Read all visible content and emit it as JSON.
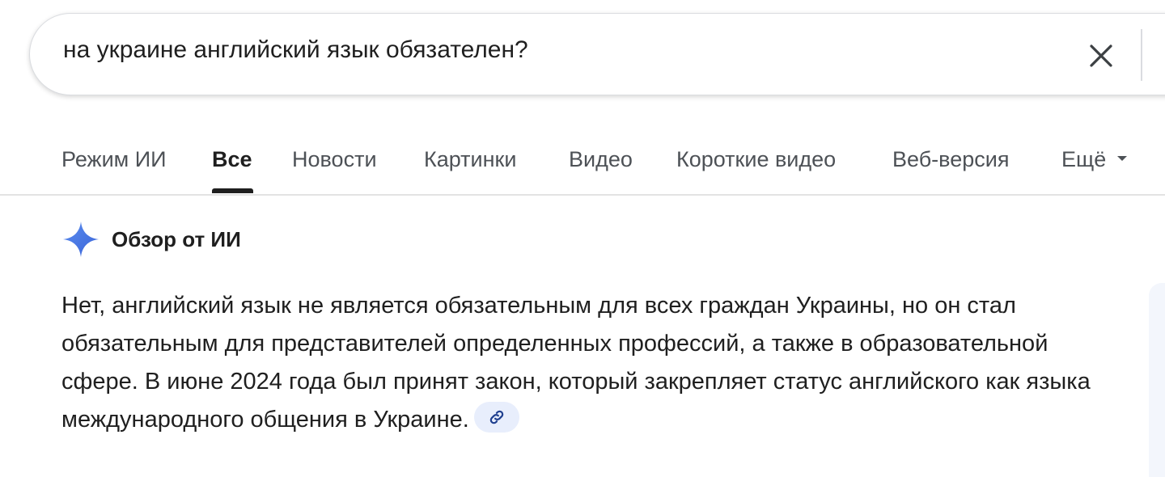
{
  "search": {
    "query": "на украине английский язык обязателен?",
    "clear_icon": "close-icon"
  },
  "tabs": [
    {
      "label": "Режим ИИ",
      "active": false
    },
    {
      "label": "Все",
      "active": true
    },
    {
      "label": "Новости",
      "active": false
    },
    {
      "label": "Картинки",
      "active": false
    },
    {
      "label": "Видео",
      "active": false
    },
    {
      "label": "Короткие видео",
      "active": false
    },
    {
      "label": "Веб-версия",
      "active": false
    },
    {
      "label": "Ещё",
      "active": false,
      "icon": "caret-down-icon"
    }
  ],
  "ai_overview": {
    "icon": "sparkle-icon",
    "title": "Обзор от ИИ",
    "text": "Нет, английский язык не является обязательным для всех граждан Украины, но он стал обязательным для представителей определенных профессий, а также в образовательной сфере. В июне 2024 года был принят закон, который закрепляет статус английского как языка международного общения в Украине.",
    "link_icon": "link-icon"
  },
  "colors": {
    "accent_blue": "#4a7cf0",
    "link_chip_bg": "#e8eefc",
    "tab_inactive": "#4d5156",
    "text": "#1f1f1f"
  }
}
